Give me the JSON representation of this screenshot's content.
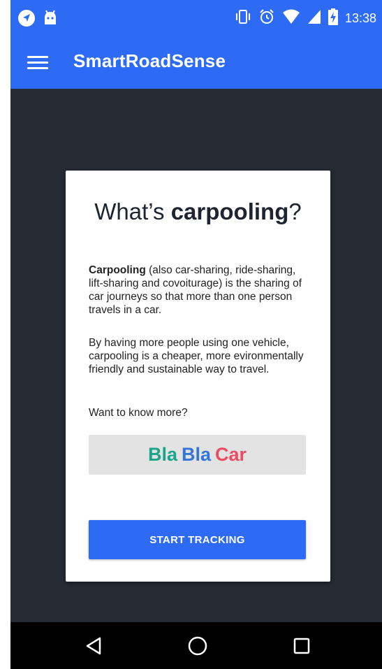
{
  "status_bar": {
    "time": "13:38",
    "icons": [
      "navigation-icon",
      "android-icon",
      "vibrate-icon",
      "alarm-icon",
      "wifi-icon",
      "signal-icon",
      "battery-charging-icon"
    ]
  },
  "app_bar": {
    "title": "SmartRoadSense",
    "menu_icon": "hamburger-menu-icon"
  },
  "card": {
    "heading_prefix": "What’s ",
    "heading_bold": "carpooling",
    "heading_suffix": "?",
    "paragraph1_bold": "Carpooling",
    "paragraph1_rest": " (also car-sharing, ride-sharing, lift-sharing and covoiturage) is the sharing of car journeys so that more than one person travels in a car.",
    "paragraph2": "By having more people using one vehicle, carpooling is a cheaper, more evironmentally friendly and sustainable way to travel.",
    "paragraph3": "Want to know more?",
    "blablacar": {
      "word1": "Bla",
      "word2": "Bla",
      "word3": "Car",
      "colors": [
        "#1aa48a",
        "#3475d5",
        "#ea4d63"
      ]
    },
    "start_button_label": "START TRACKING"
  },
  "nav_bar": {
    "back_icon": "back-triangle-icon",
    "home_icon": "home-circle-icon",
    "recents_icon": "recents-square-icon"
  },
  "colors": {
    "accent": "#2e6bf5",
    "background": "#262a33",
    "card": "#ffffff"
  }
}
